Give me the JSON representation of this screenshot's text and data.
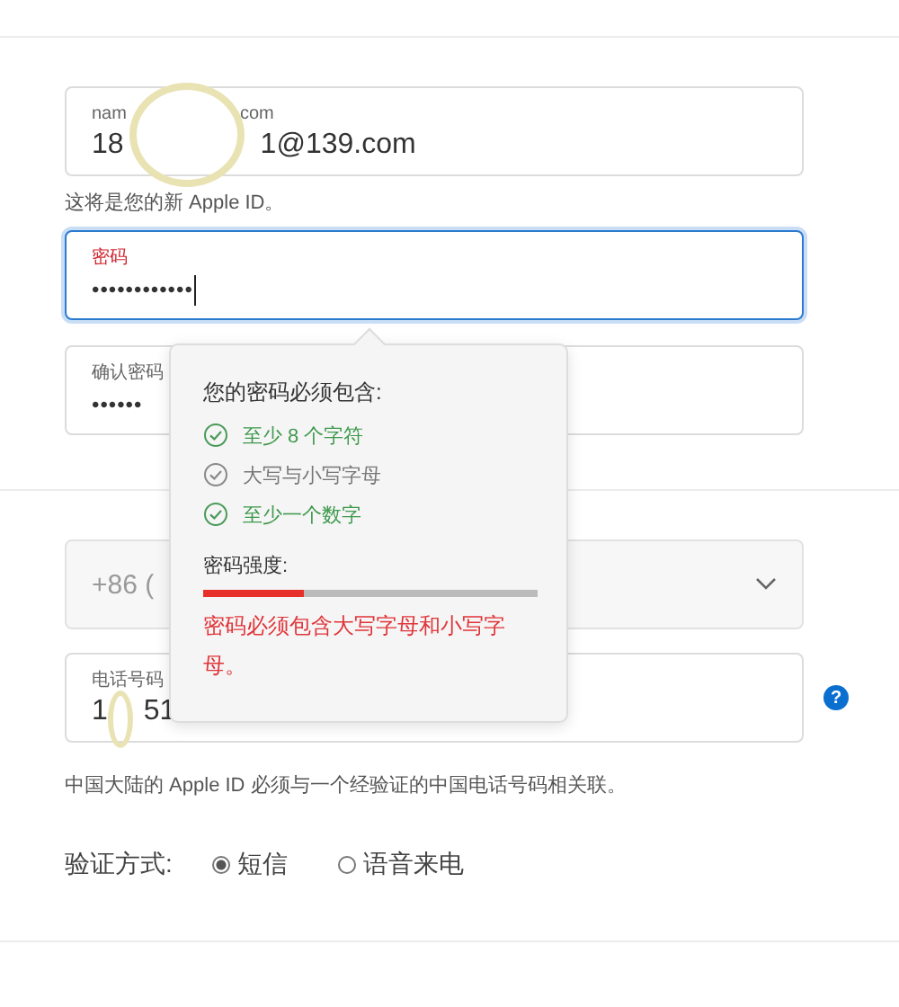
{
  "email_field": {
    "label": [
      "nam",
      "com"
    ],
    "value": [
      "18",
      "1@139.com"
    ]
  },
  "email_hint": "这将是您的新 Apple ID。",
  "password_field": {
    "label": "密码",
    "value": "••••••••••••",
    "focused": true
  },
  "confirm_field": {
    "label": "确认密码",
    "value": "••••••"
  },
  "country_select": {
    "value": "+86 ("
  },
  "phone_field": {
    "label": "电话号码",
    "value": [
      "1",
      "51"
    ]
  },
  "help_button": "?",
  "phone_note": "中国大陆的 Apple ID 必须与一个经验证的中国电话号码相关联。",
  "verification": {
    "label": "验证方式:",
    "options": [
      {
        "label": "短信",
        "selected": true
      },
      {
        "label": "语音来电",
        "selected": false
      }
    ]
  },
  "password_popup": {
    "title": "您的密码必须包含:",
    "rules": [
      {
        "text": "至少 8 个字符",
        "met": true
      },
      {
        "text": "大写与小写字母",
        "met": false
      },
      {
        "text": "至少一个数字",
        "met": true
      }
    ],
    "strength_label": "密码强度:",
    "strength": {
      "level": 0.3
    },
    "error": "密码必须包含大写字母和小写字母。"
  }
}
